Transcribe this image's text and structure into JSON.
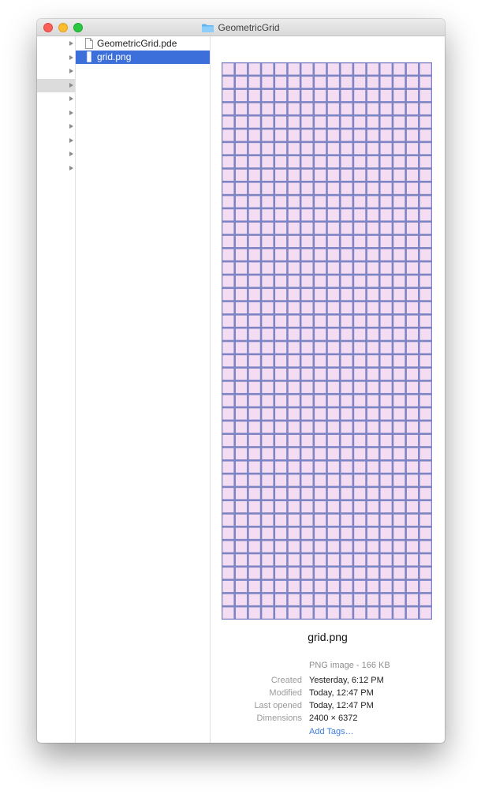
{
  "window": {
    "title": "GeometricGrid"
  },
  "column1": {
    "row_count": 10,
    "selected_index": 3
  },
  "files": [
    {
      "name": "GeometricGrid.pde",
      "icon": "document-icon",
      "selected": false
    },
    {
      "name": "grid.png",
      "icon": "image-file-icon",
      "selected": true
    }
  ],
  "preview": {
    "filename": "grid.png",
    "kind": "PNG image - 166 KB",
    "fields": [
      {
        "label": "Created",
        "value": "Yesterday, 6:12 PM"
      },
      {
        "label": "Modified",
        "value": "Today, 12:47 PM"
      },
      {
        "label": "Last opened",
        "value": "Today, 12:47 PM"
      },
      {
        "label": "Dimensions",
        "value": "2400 × 6372"
      }
    ],
    "add_tags": "Add Tags…",
    "grid_colors": {
      "cell": "#f4dcf2",
      "line": "#7d84c4"
    },
    "grid": {
      "columns": 16,
      "rows": 42
    }
  }
}
